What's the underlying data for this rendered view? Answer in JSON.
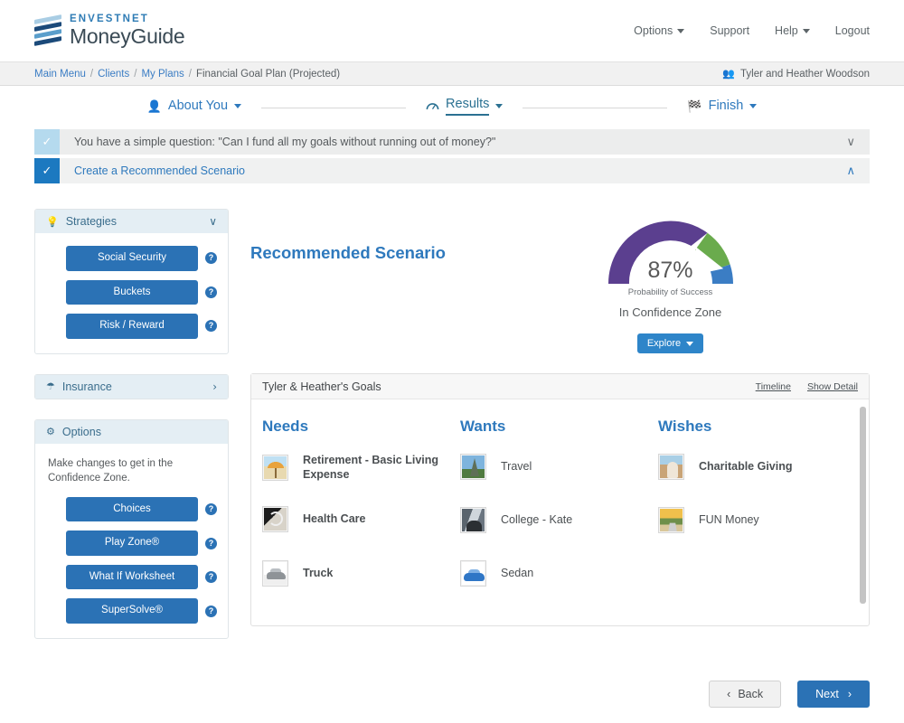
{
  "brand": {
    "line1": "ENVESTNET",
    "line2": "MoneyGuide",
    "accent_blue": "#2e79bd",
    "logo_blue": "#2f7cb5",
    "logo_dark": "#1b4a7a"
  },
  "topnav": [
    {
      "label": "Options",
      "has_caret": true
    },
    {
      "label": "Support",
      "has_caret": false
    },
    {
      "label": "Help",
      "has_caret": true
    },
    {
      "label": "Logout",
      "has_caret": false
    }
  ],
  "breadcrumb": {
    "items": [
      {
        "label": "Main Menu",
        "link": true
      },
      {
        "label": "Clients",
        "link": true
      },
      {
        "label": "My Plans",
        "link": true
      },
      {
        "label": "Financial Goal Plan (Projected)",
        "link": false
      }
    ],
    "separator": "/"
  },
  "client": {
    "name": "Tyler and Heather Woodson",
    "icon": "people-icon"
  },
  "stepper": {
    "steps": [
      {
        "label": "About You",
        "icon": "person-icon",
        "active": false
      },
      {
        "label": "Results",
        "icon": "gauge-icon",
        "active": true
      },
      {
        "label": "Finish",
        "icon": "flag-icon",
        "active": false
      }
    ]
  },
  "accordions": [
    {
      "label": "You have a simple question: \"Can I fund all my goals without running out of money?\"",
      "checked": true,
      "check_style": "pale",
      "expanded": false,
      "chevron": "chevron-down-icon",
      "chevron_glyph": "∨"
    },
    {
      "label": "Create a Recommended Scenario",
      "checked": true,
      "check_style": "solid",
      "expanded": true,
      "chevron": "chevron-up-icon",
      "chevron_glyph": "∧"
    }
  ],
  "sidebar": {
    "strategies": {
      "title": "Strategies",
      "icon": "lightbulb-icon",
      "icon_glyph": "⚲",
      "expanded": true,
      "chevron_glyph": "∨",
      "buttons": [
        {
          "label": "Social Security",
          "help": "?"
        },
        {
          "label": "Buckets",
          "help": "?"
        },
        {
          "label": "Risk / Reward",
          "help": "?"
        }
      ]
    },
    "insurance": {
      "title": "Insurance",
      "icon": "umbrella-icon",
      "icon_glyph": "☂",
      "expanded": false,
      "chevron_glyph": "›"
    },
    "options": {
      "title": "Options",
      "icon": "gear-icon",
      "icon_glyph": "⚙",
      "note": "Make changes to get in the Confidence Zone.",
      "buttons": [
        {
          "label": "Choices",
          "help": "?"
        },
        {
          "label": "Play Zone®",
          "help": "?"
        },
        {
          "label": "What If Worksheet",
          "help": "?"
        },
        {
          "label": "SuperSolve®",
          "help": "?"
        }
      ]
    }
  },
  "results": {
    "title": "Recommended Scenario",
    "explore_label": "Explore"
  },
  "chart_data": {
    "type": "gauge",
    "title": "Probability of Success",
    "value": 87,
    "value_label": "87%",
    "sublabel": "Probability of Success",
    "status_label": "In Confidence Zone",
    "range": [
      0,
      100
    ],
    "needle_value": 87,
    "segments": [
      {
        "name": "Below Confidence Zone",
        "from": 0,
        "to": 70,
        "color": "#5b3f8f"
      },
      {
        "name": "Confidence Zone",
        "from": 70,
        "to": 90,
        "color": "#6aab4d"
      },
      {
        "name": "Above Confidence Zone",
        "from": 90,
        "to": 100,
        "color": "#3b7dc4"
      }
    ],
    "needle_color": "#ffffff"
  },
  "goals": {
    "card_title": "Tyler & Heather's Goals",
    "links": [
      {
        "label": "Timeline"
      },
      {
        "label": "Show Detail"
      }
    ],
    "columns": [
      {
        "heading": "Needs",
        "items": [
          {
            "label": "Retirement - Basic Living Expense",
            "thumb": "beach-umbrella-thumbnail",
            "art": "art-beach"
          },
          {
            "label": "Health Care",
            "thumb": "stethoscope-thumbnail",
            "art": "art-health"
          },
          {
            "label": "Truck",
            "thumb": "truck-thumbnail",
            "art": "art-truck"
          }
        ]
      },
      {
        "heading": "Wants",
        "items": [
          {
            "label": "Travel",
            "thumb": "eiffel-tower-thumbnail",
            "art": "art-travel"
          },
          {
            "label": "College - Kate",
            "thumb": "graduation-thumbnail",
            "art": "art-college"
          },
          {
            "label": "Sedan",
            "thumb": "sedan-thumbnail",
            "art": "art-sedan"
          }
        ]
      },
      {
        "heading": "Wishes",
        "items": [
          {
            "label": "Charitable Giving",
            "thumb": "charity-thumbnail",
            "art": "art-charity"
          },
          {
            "label": "FUN Money",
            "thumb": "road-sunset-thumbnail",
            "art": "art-fun"
          }
        ]
      }
    ]
  },
  "footer": {
    "back_label": "Back",
    "back_caret": "‹",
    "next_label": "Next",
    "next_caret": "›"
  }
}
